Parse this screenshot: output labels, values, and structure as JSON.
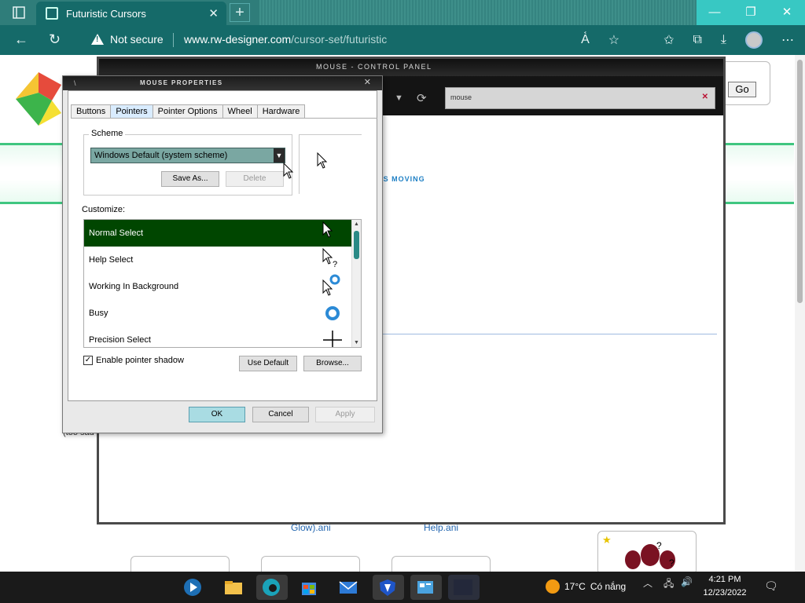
{
  "browser": {
    "tab_title": "Futuristic Cursors",
    "security_label": "Not secure",
    "url_host": "www.rw-designer.com",
    "url_path": "/cursor-set/futuristic"
  },
  "page": {
    "go_label": "Go",
    "link1": "Glow).ani",
    "link2": "Help.ani",
    "side_text": "(too sad"
  },
  "control_panel": {
    "title": "MOUSE - CONTROL PANEL",
    "search_value": "mouse",
    "moving_text": "T'S MOVING"
  },
  "dialog": {
    "title": "MOUSE PROPERTIES",
    "tabs": [
      "Buttons",
      "Pointers",
      "Pointer Options",
      "Wheel",
      "Hardware"
    ],
    "active_tab": "Pointers",
    "scheme_label": "Scheme",
    "scheme_value": "Windows Default (system scheme)",
    "save_as": "Save As...",
    "delete": "Delete",
    "customize_label": "Customize:",
    "pointers": [
      {
        "name": "Normal Select",
        "icon": "arrow-cursor-icon"
      },
      {
        "name": "Help Select",
        "icon": "help-cursor-icon"
      },
      {
        "name": "Working In Background",
        "icon": "working-cursor-icon"
      },
      {
        "name": "Busy",
        "icon": "busy-cursor-icon"
      },
      {
        "name": "Precision Select",
        "icon": "crosshair-cursor-icon"
      }
    ],
    "shadow_label": "Enable pointer shadow",
    "shadow_checked": true,
    "use_default": "Use Default",
    "browse": "Browse...",
    "ok": "OK",
    "cancel": "Cancel",
    "apply": "Apply"
  },
  "taskbar": {
    "temperature": "17°C",
    "weather_text": "Có nắng",
    "time": "4:21 PM",
    "date": "12/23/2022"
  },
  "colors": {
    "browser_teal": "#156a69",
    "selection_green": "#004600",
    "accent_cyan": "#38c8c3"
  }
}
